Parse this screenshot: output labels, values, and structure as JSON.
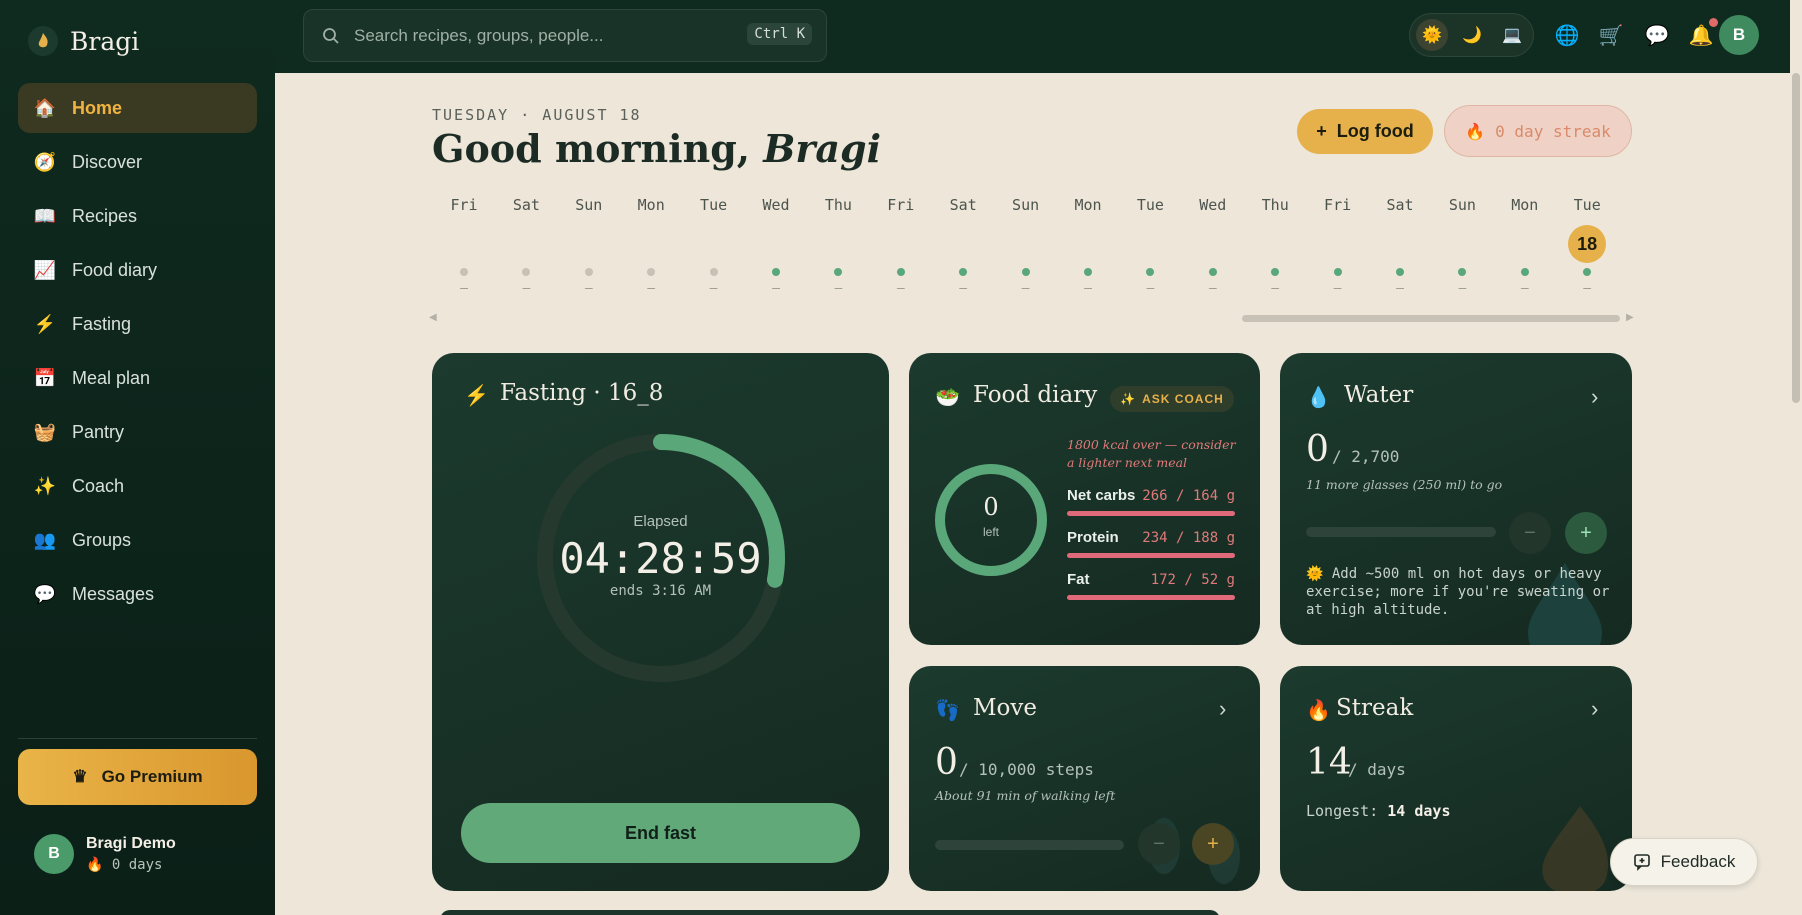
{
  "brand": {
    "name": "Bragi"
  },
  "sidebar": {
    "items": [
      {
        "label": "Home",
        "icon": "home-icon",
        "glyph": "🏠"
      },
      {
        "label": "Discover",
        "icon": "compass-icon",
        "glyph": "🧭"
      },
      {
        "label": "Recipes",
        "icon": "book-icon",
        "glyph": "📖"
      },
      {
        "label": "Food diary",
        "icon": "chart-icon",
        "glyph": "📈"
      },
      {
        "label": "Fasting",
        "icon": "bolt-icon",
        "glyph": "⚡"
      },
      {
        "label": "Meal plan",
        "icon": "calendar-icon",
        "glyph": "📅"
      },
      {
        "label": "Pantry",
        "icon": "basket-icon",
        "glyph": "🧺"
      },
      {
        "label": "Coach",
        "icon": "sparkles-icon",
        "glyph": "✨"
      },
      {
        "label": "Groups",
        "icon": "people-icon",
        "glyph": "👥"
      },
      {
        "label": "Messages",
        "icon": "speech-bubble-icon",
        "glyph": "💬"
      }
    ],
    "premium_label": "Go Premium",
    "profile": {
      "initial": "B",
      "name": "Bragi Demo",
      "streak": "0 days"
    }
  },
  "topbar": {
    "search_placeholder": "Search recipes, groups, people...",
    "search_shortcut": "Ctrl K",
    "avatar_initial": "B"
  },
  "header": {
    "date": "TUESDAY · AUGUST 18",
    "greeting_prefix": "Good morning,",
    "greeting_name": "Bragi",
    "log_food_label": "Log food",
    "streak_label": "0 day streak"
  },
  "days": [
    {
      "label": "Fri",
      "logged": false
    },
    {
      "label": "Sat",
      "logged": false
    },
    {
      "label": "Sun",
      "logged": false
    },
    {
      "label": "Mon",
      "logged": false
    },
    {
      "label": "Tue",
      "logged": false
    },
    {
      "label": "Wed",
      "logged": true
    },
    {
      "label": "Thu",
      "logged": true
    },
    {
      "label": "Fri",
      "logged": true
    },
    {
      "label": "Sat",
      "logged": true
    },
    {
      "label": "Sun",
      "logged": true
    },
    {
      "label": "Mon",
      "logged": true
    },
    {
      "label": "Tue",
      "logged": true
    },
    {
      "label": "Wed",
      "logged": true
    },
    {
      "label": "Thu",
      "logged": true
    },
    {
      "label": "Fri",
      "logged": true
    },
    {
      "label": "Sat",
      "logged": true
    },
    {
      "label": "Sun",
      "logged": true
    },
    {
      "label": "Mon",
      "logged": true
    },
    {
      "label": "Tue",
      "logged": true,
      "today": "18"
    }
  ],
  "day_dash": "–",
  "fasting": {
    "title": "Fasting · 16_8",
    "elapsed_label": "Elapsed",
    "elapsed": "04:28:59",
    "ends": "ends 3:16 AM",
    "progress": 0.28,
    "button": "End fast"
  },
  "food": {
    "title": "Food diary",
    "ask_coach": "ASK COACH",
    "remaining": "0",
    "remaining_label": "left",
    "note": "1800 kcal over — consider a lighter next meal",
    "macros": [
      {
        "name": "Net carbs",
        "value": "266 / 164 g",
        "fill": 1.0
      },
      {
        "name": "Protein",
        "value": "234 / 188 g",
        "fill": 1.0
      },
      {
        "name": "Fat",
        "value": "172 / 52 g",
        "fill": 1.0
      }
    ]
  },
  "water": {
    "title": "Water",
    "value": "0",
    "goal": "/ 2,700",
    "sub": "11 more glasses (250 ml) to go",
    "tip": "Add ~500 ml on hot days or heavy exercise; more if you're sweating or at high altitude.",
    "minus": "−",
    "plus": "+"
  },
  "move": {
    "title": "Move",
    "value": "0",
    "goal": "/ 10,000 steps",
    "sub": "About 91 min of walking left",
    "minus": "−",
    "plus": "+"
  },
  "streak": {
    "title": "Streak",
    "value": "14",
    "unit": "/ days",
    "longest_label": "Longest:",
    "longest_value": "14 days"
  },
  "feedback_label": "Feedback"
}
